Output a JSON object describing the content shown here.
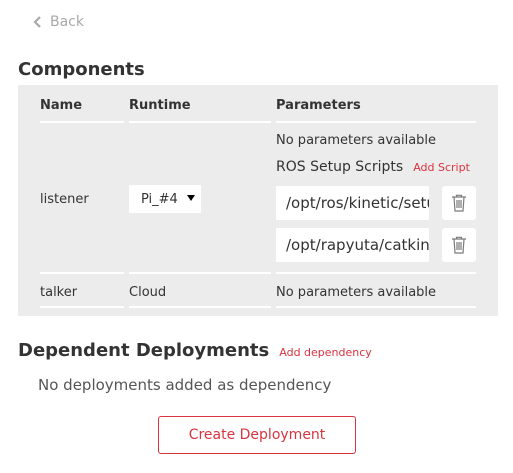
{
  "back_label": "Back",
  "components": {
    "title": "Components",
    "headers": {
      "name": "Name",
      "runtime": "Runtime",
      "parameters": "Parameters"
    },
    "rows": [
      {
        "name": "listener",
        "runtime": "Pi_#4",
        "parameters_text": "No parameters available",
        "ros_setup_scripts_label": "ROS Setup Scripts",
        "add_script_label": "Add Script",
        "scripts": [
          "/opt/ros/kinetic/setup.bash",
          "/opt/rapyuta/catkin_ws/devel/setup.bash"
        ]
      },
      {
        "name": "talker",
        "runtime": "Cloud",
        "parameters_text": "No parameters available"
      }
    ]
  },
  "dependent_deployments": {
    "title": "Dependent Deployments",
    "add_label": "Add dependency",
    "empty_text": "No deployments added as dependency"
  },
  "create_button_label": "Create Deployment",
  "colors": {
    "accent": "#d8343f",
    "panel_bg": "#ececec",
    "muted": "#a9a9a9"
  },
  "icons": {
    "back": "chevron-left-icon",
    "delete": "trash-icon",
    "select": "caret-down-icon"
  }
}
